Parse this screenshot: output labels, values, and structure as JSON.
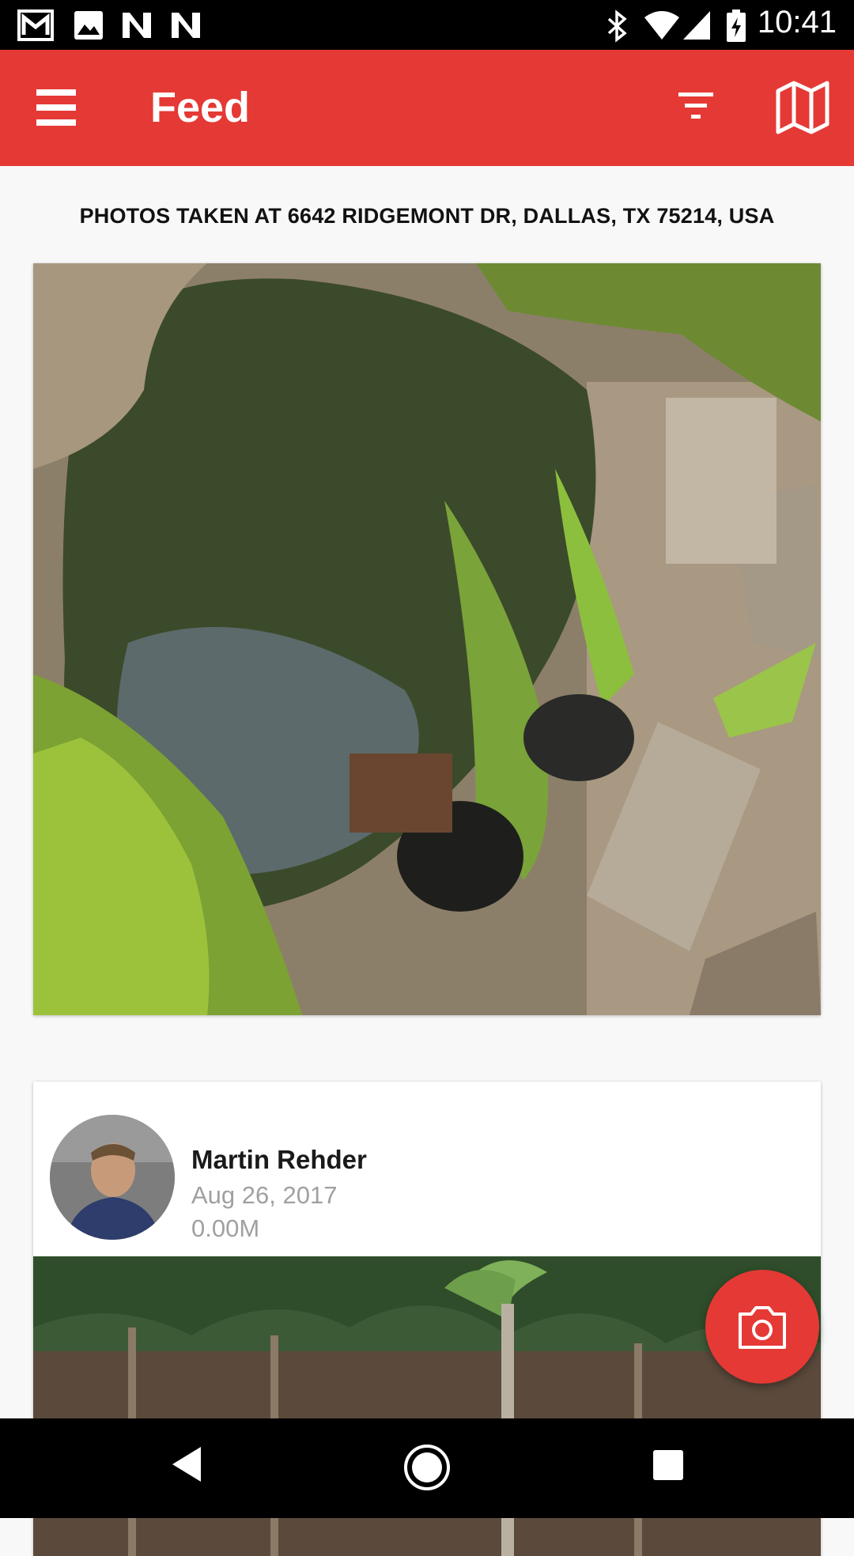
{
  "status_bar": {
    "time": "10:41",
    "left_icons": [
      "gmail-icon",
      "image-icon",
      "n-app-icon",
      "n-app-icon"
    ],
    "right_icons": [
      "bluetooth-icon",
      "wifi-icon",
      "signal-icon",
      "battery-charging-icon"
    ]
  },
  "app_bar": {
    "title": "Feed",
    "background": "#e53935",
    "icons": [
      "menu-icon",
      "filter-icon",
      "map-icon"
    ]
  },
  "location_heading": "PHOTOS TAKEN AT 6642 RIDGEMONT DR, DALLAS, TX 75214, USA",
  "posts": [
    {
      "author": "Martin Rehder",
      "date": "Aug 26, 2017",
      "distance": "0.00M"
    }
  ],
  "fab": {
    "icon": "camera-icon",
    "color": "#e53935"
  },
  "nav_bar": {
    "buttons": [
      "back-icon",
      "home-icon",
      "recents-icon"
    ]
  }
}
